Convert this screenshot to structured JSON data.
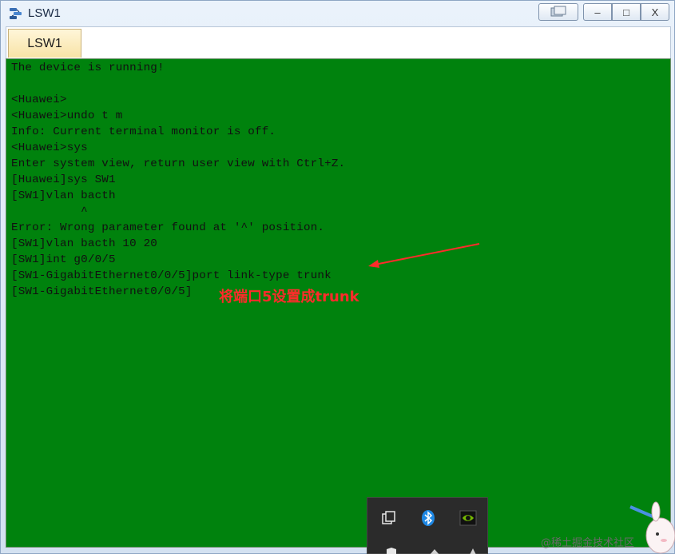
{
  "window": {
    "title": "LSW1",
    "buttons": {
      "restore_box": "restore-windows",
      "minimize": "–",
      "maximize": "□",
      "close": "X"
    }
  },
  "tabs": [
    {
      "label": "LSW1",
      "active": true
    }
  ],
  "terminal": {
    "background": "#00820d",
    "lines": [
      "The device is running!",
      "",
      "<Huawei>",
      "<Huawei>undo t m",
      "Info: Current terminal monitor is off.",
      "<Huawei>sys",
      "Enter system view, return user view with Ctrl+Z.",
      "[Huawei]sys SW1",
      "[SW1]vlan bacth",
      "          ^",
      "Error: Wrong parameter found at '^' position.",
      "[SW1]vlan bacth 10 20",
      "[SW1]int g0/0/5",
      "[SW1-GigabitEthernet0/0/5]port link-type trunk",
      "[SW1-GigabitEthernet0/0/5]"
    ]
  },
  "annotation": {
    "text": "将端口5设置成trunk",
    "color": "#ff2b2b"
  },
  "tray": {
    "icons": [
      "copy-icon",
      "bluetooth-icon",
      "nvidia-icon"
    ]
  },
  "watermark": "@稀土掘金技术社区"
}
